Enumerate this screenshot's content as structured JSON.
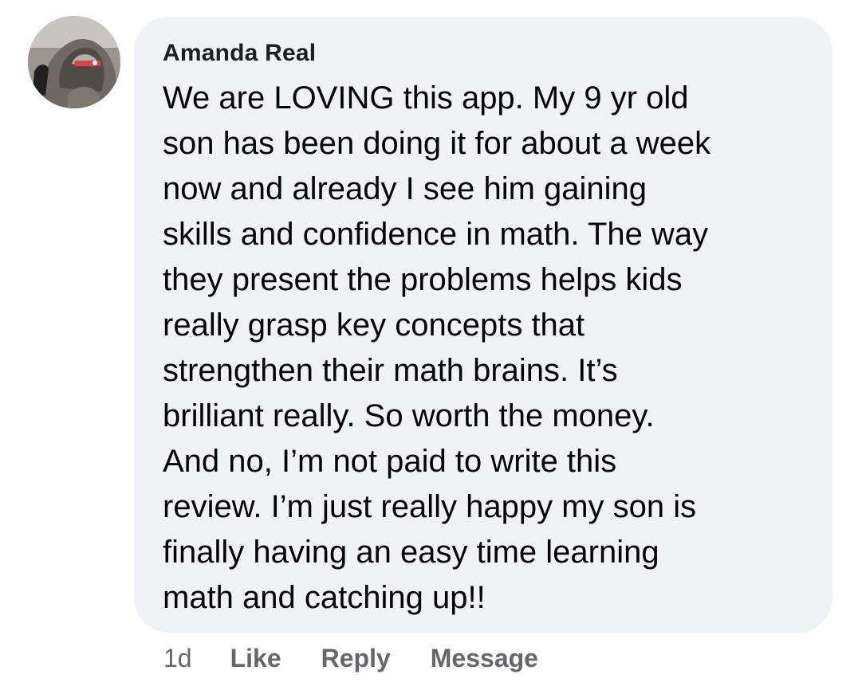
{
  "comment": {
    "author": "Amanda Real",
    "lines": [
      "We are LOVING this app. My 9 yr old",
      "son has been doing it for about a week",
      "now and already I see him gaining",
      "skills and confidence in math. The way",
      "they present the problems helps kids",
      "really grasp key concepts that",
      "strengthen their math brains. It’s",
      "brilliant really. So worth the money.",
      "And no, I’m not paid to write this",
      "review. I’m just really happy my son is",
      "finally having an easy time learning",
      "math and catching up!!"
    ]
  },
  "actions": {
    "time": "1d",
    "like": "Like",
    "reply": "Reply",
    "message": "Message"
  },
  "colors": {
    "bubble": "#f0f2f5",
    "text": "#050505",
    "muted": "#65676b"
  }
}
